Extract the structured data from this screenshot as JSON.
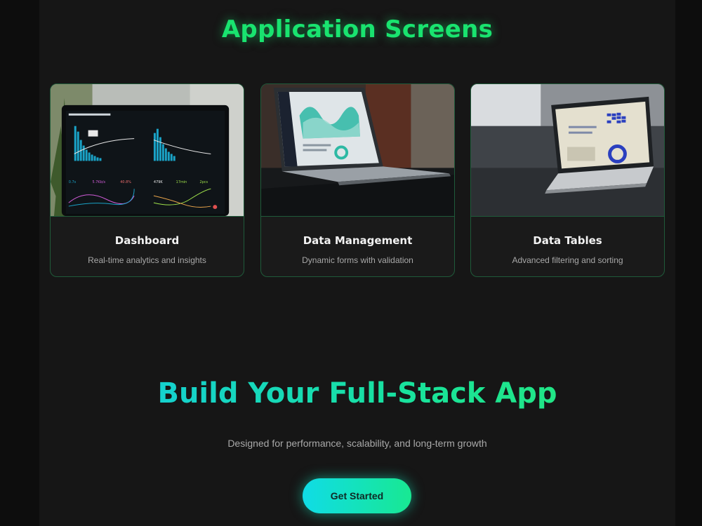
{
  "section": {
    "title": "Application Screens"
  },
  "cards": [
    {
      "name": "Dashboard",
      "description": "Real-time analytics and insights"
    },
    {
      "name": "Data Management",
      "description": "Dynamic forms with validation"
    },
    {
      "name": "Data Tables",
      "description": "Advanced filtering and sorting"
    }
  ],
  "hero": {
    "title": "Build Your Full-Stack App",
    "subtitle": "Designed for performance, scalability, and long-term growth",
    "cta_label": "Get Started"
  },
  "colors": {
    "accent_green": "#19e36f",
    "accent_cyan": "#13c9e6",
    "card_border": "#1f5b3a",
    "background": "#161616"
  }
}
